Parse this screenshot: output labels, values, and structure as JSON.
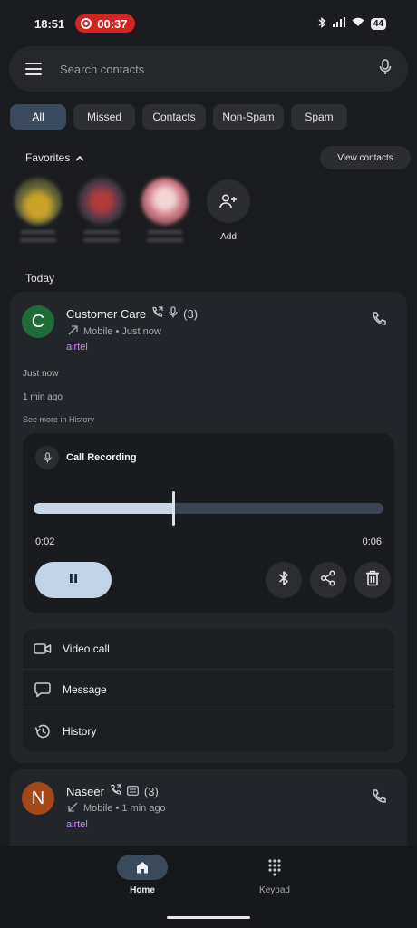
{
  "status_bar": {
    "time": "18:51",
    "recording_timer": "00:37",
    "battery": "44"
  },
  "search": {
    "placeholder": "Search contacts"
  },
  "filters": [
    "All",
    "Missed",
    "Contacts",
    "Non-Spam",
    "Spam"
  ],
  "favorites": {
    "title": "Favorites",
    "view_contacts": "View contacts",
    "add_label": "Add"
  },
  "section_today": "Today",
  "entry1": {
    "avatar_letter": "C",
    "avatar_color": "#1f6b3a",
    "name": "Customer Care",
    "count": "(3)",
    "subtitle": "Mobile • Just now",
    "carrier": "airtel",
    "history": [
      "Just now",
      "1 min ago"
    ],
    "see_more": "See more in History"
  },
  "recording": {
    "title": "Call Recording",
    "elapsed": "0:02",
    "total": "0:06",
    "progress_fraction": 0.4
  },
  "actions": {
    "video_call": "Video call",
    "message": "Message",
    "history": "History"
  },
  "entry2": {
    "avatar_letter": "N",
    "avatar_color": "#a4471a",
    "name": "Naseer",
    "count": "(3)",
    "subtitle": "Mobile • 1 min ago",
    "carrier": "airtel"
  },
  "nav": {
    "home": "Home",
    "keypad": "Keypad"
  },
  "colors": {
    "accent": "#c3d4e6",
    "recording_red": "#d5241f",
    "carrier_purple": "#c48af0"
  }
}
